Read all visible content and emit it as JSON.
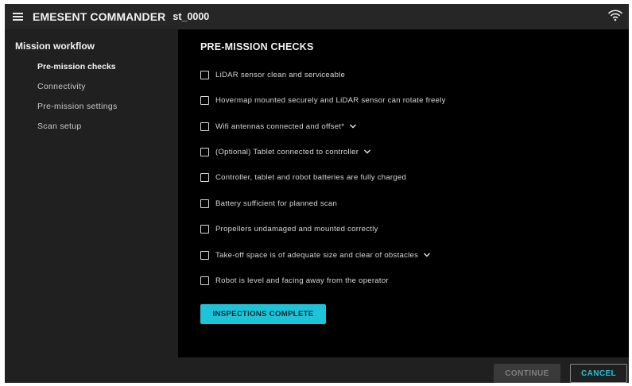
{
  "header": {
    "app_title": "EMESENT COMMANDER",
    "session_id": "st_0000",
    "menu_icon": "hamburger-menu-icon",
    "status_icon": "wifi-icon"
  },
  "sidebar": {
    "heading": "Mission workflow",
    "items": [
      {
        "label": "Pre-mission checks",
        "active": true
      },
      {
        "label": "Connectivity",
        "active": false
      },
      {
        "label": "Pre-mission settings",
        "active": false
      },
      {
        "label": "Scan setup",
        "active": false
      }
    ]
  },
  "main": {
    "title": "PRE-MISSION CHECKS",
    "degree_mark": "°",
    "checks": [
      {
        "label": "LiDAR sensor clean and serviceable",
        "checked": false,
        "expandable": false
      },
      {
        "label": "Hovermap mounted securely and LiDAR sensor can rotate freely",
        "checked": false,
        "expandable": false
      },
      {
        "label": "Wifi antennas connected and offset*",
        "checked": false,
        "expandable": true
      },
      {
        "label": "(Optional) Tablet connected to controller",
        "checked": false,
        "expandable": true
      },
      {
        "label": "Controller, tablet and robot batteries are fully charged",
        "checked": false,
        "expandable": false
      },
      {
        "label": "Battery sufficient for planned scan",
        "checked": false,
        "expandable": false
      },
      {
        "label": "Propellers undamaged and mounted correctly",
        "checked": false,
        "expandable": false
      },
      {
        "label": "Take-off space is of adequate size and clear of obstacles",
        "checked": false,
        "expandable": true
      },
      {
        "label": "Robot is level and facing away from the operator",
        "checked": false,
        "expandable": false
      }
    ],
    "primary_button": "INSPECTIONS COMPLETE"
  },
  "footer": {
    "continue_label": "CONTINUE",
    "continue_enabled": false,
    "cancel_label": "CANCEL"
  },
  "colors": {
    "accent": "#1fc3d8",
    "background": "#202020",
    "panel": "#000000"
  }
}
